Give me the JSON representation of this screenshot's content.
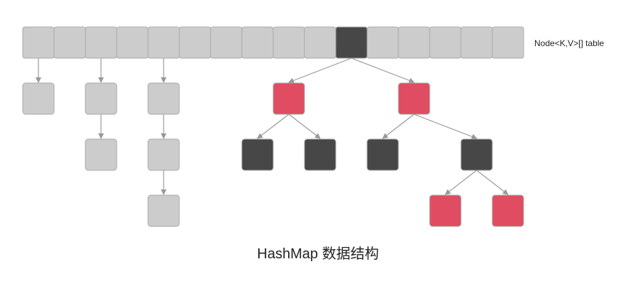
{
  "table_label": "Node<K,V>[] table",
  "caption": "HashMap 数据结构",
  "colors": {
    "bucket": "#cccccc",
    "bucket_border": "#a9a9a9",
    "active_bucket": "#474747",
    "black_node": "#474747",
    "red_node": "#e04c61",
    "list_node": "#cccccc",
    "arrow": "#999999"
  },
  "table": {
    "bucket_count": 16,
    "tree_bucket_index": 10
  },
  "linked_lists": [
    {
      "bucket_index": 0,
      "length": 1
    },
    {
      "bucket_index": 2,
      "length": 2
    },
    {
      "bucket_index": 4,
      "length": 3
    }
  ],
  "red_black_tree": {
    "color": "black",
    "children": [
      {
        "color": "red",
        "children": [
          {
            "color": "black",
            "children": []
          },
          {
            "color": "black",
            "children": []
          }
        ]
      },
      {
        "color": "red",
        "children": [
          {
            "color": "black",
            "children": []
          },
          {
            "color": "black",
            "children": [
              {
                "color": "red",
                "children": []
              },
              {
                "color": "red",
                "children": []
              }
            ]
          }
        ]
      }
    ]
  }
}
